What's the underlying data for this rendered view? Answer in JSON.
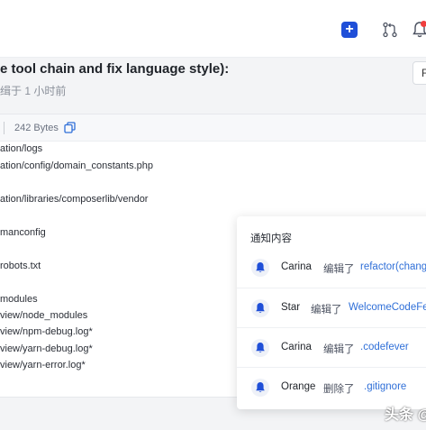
{
  "topbar": {
    "new_label": "+",
    "icons": [
      "plus-icon",
      "git-pull-request-icon",
      "bell-icon"
    ],
    "accent_color": "#1f4fd8",
    "notification_dot_color": "#f03e3e"
  },
  "commit": {
    "title": "e tool chain and fix language style):",
    "meta": "缉于 1 小时前",
    "browse_label": "F"
  },
  "file": {
    "size": "242 Bytes",
    "lines": [
      "ation/logs",
      "ation/config/domain_constants.php",
      "ation/libraries/composerlib/vendor",
      "manconfig",
      "robots.txt",
      "modules",
      "view/node_modules",
      "view/npm-debug.log*",
      "view/yarn-debug.log*",
      "view/yarn-error.log*"
    ]
  },
  "notifications": {
    "title": "通知内容",
    "items": [
      {
        "user": "Carina",
        "action": "编辑了",
        "target": "refactor(chang"
      },
      {
        "user": "Star",
        "action": "编辑了",
        "target": "WelcomeCodeFe"
      },
      {
        "user": "Carina",
        "action": "编辑了",
        "target": ".codefever"
      },
      {
        "user": "Orange",
        "action": "删除了",
        "target": ".gitignore"
      }
    ]
  },
  "watermark": "头条 @"
}
